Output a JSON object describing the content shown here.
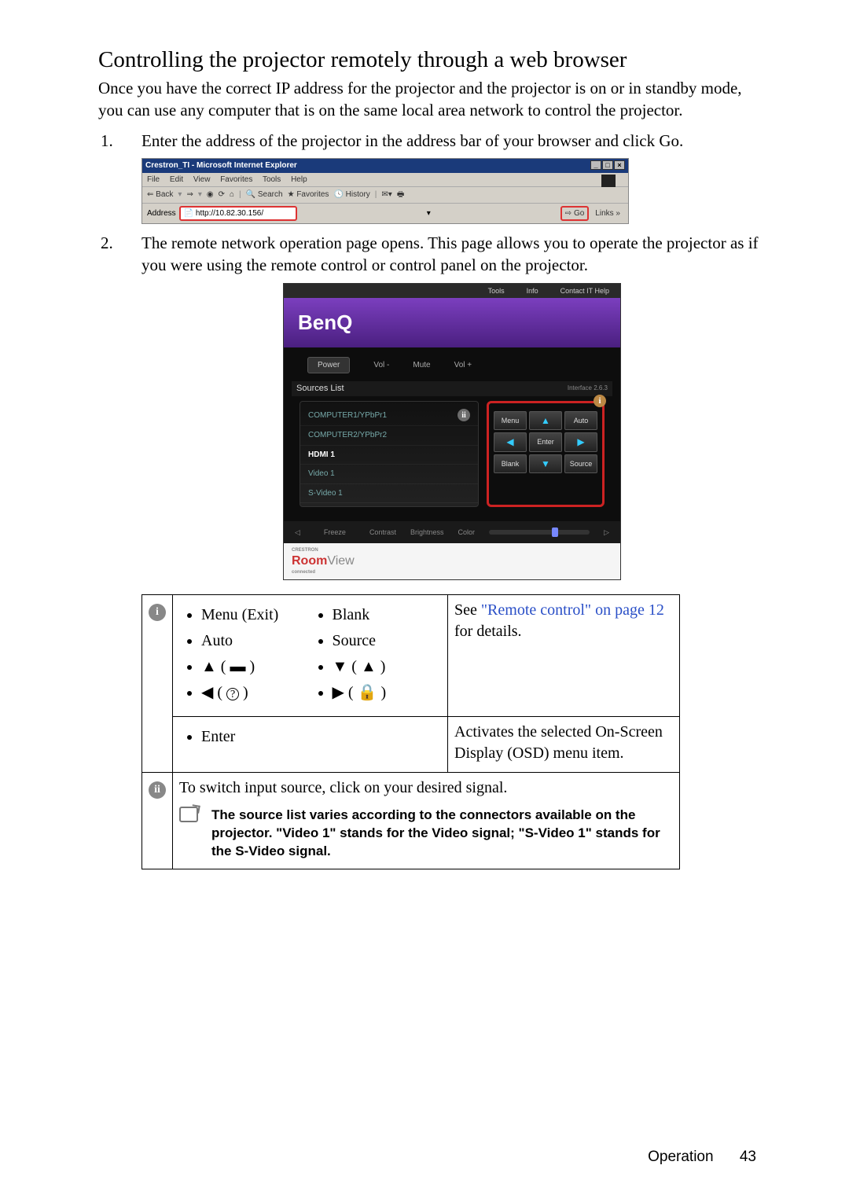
{
  "title": "Controlling the projector remotely through a web browser",
  "intro": "Once you have the correct IP address for the projector and the projector is on or in standby mode, you can use any computer that is on the same local area network to control the projector.",
  "steps": {
    "s1": "Enter the address of the projector in the address bar of your browser and click Go.",
    "s2": "The remote network operation page opens. This page allows you to operate the projector as if you were using the remote control or control panel on the projector."
  },
  "browser": {
    "title": "Crestron_TI - Microsoft Internet Explorer",
    "menu": {
      "file": "File",
      "edit": "Edit",
      "view": "View",
      "favorites": "Favorites",
      "tools": "Tools",
      "help": "Help"
    },
    "toolbar": {
      "back": "Back",
      "search": "Search",
      "favorites": "Favorites",
      "history": "History"
    },
    "address_label": "Address",
    "address_value": "http://10.82.30.156/",
    "go": "Go",
    "links": "Links",
    "win_min": "_",
    "win_max": "□",
    "win_close": "×"
  },
  "panel": {
    "tabs": {
      "tools": "Tools",
      "info": "Info",
      "contact": "Contact IT Help"
    },
    "brand": "BenQ",
    "controls": {
      "power": "Power",
      "volminus": "Vol -",
      "mute": "Mute",
      "volplus": "Vol +"
    },
    "sources_title": "Sources List",
    "interface": "Interface 2.6.3",
    "sources": {
      "s0": "COMPUTER1/YPbPr1",
      "s1": "COMPUTER2/YPbPr2",
      "s2": "HDMI 1",
      "s3": "Video 1",
      "s4": "S-Video 1"
    },
    "badge_ii": "ii",
    "badge_i": "i",
    "dpad": {
      "menu": "Menu",
      "auto": "Auto",
      "enter": "Enter",
      "blank": "Blank",
      "source": "Source"
    },
    "slider": {
      "freeze": "Freeze",
      "contrast": "Contrast",
      "brightness": "Brightness",
      "color": "Color"
    },
    "footer_prefix": "Room",
    "footer_suffix": "View",
    "footer_sub1": "CRESTRON",
    "footer_sub2": "connected"
  },
  "table": {
    "badge1": "i",
    "badge2": "ii",
    "items": {
      "menu": "Menu (Exit)",
      "blank": "Blank",
      "auto": "Auto",
      "source": "Source",
      "enter": "Enter"
    },
    "arrows": {
      "up_label_open": "▲ ( ",
      "up_end": " )",
      "down_label_open": "▼ ( ",
      "down_end": " )",
      "left_label_open": "◀ ( ",
      "left_end": " )",
      "right_label_open": "▶ ( ",
      "right_end": " )"
    },
    "desc1a": "See ",
    "desc1link": "\"Remote control\" on page 12",
    "desc1b": " for details.",
    "desc_enter": "Activates the selected On-Screen Display (OSD) menu item.",
    "row2": "To switch input source, click on your desired signal.",
    "note": "The source list varies according to the connectors available on the projector. \"Video 1\" stands for the Video signal; \"S-Video 1\" stands for the S-Video signal."
  },
  "footer": {
    "section": "Operation",
    "page": "43"
  }
}
